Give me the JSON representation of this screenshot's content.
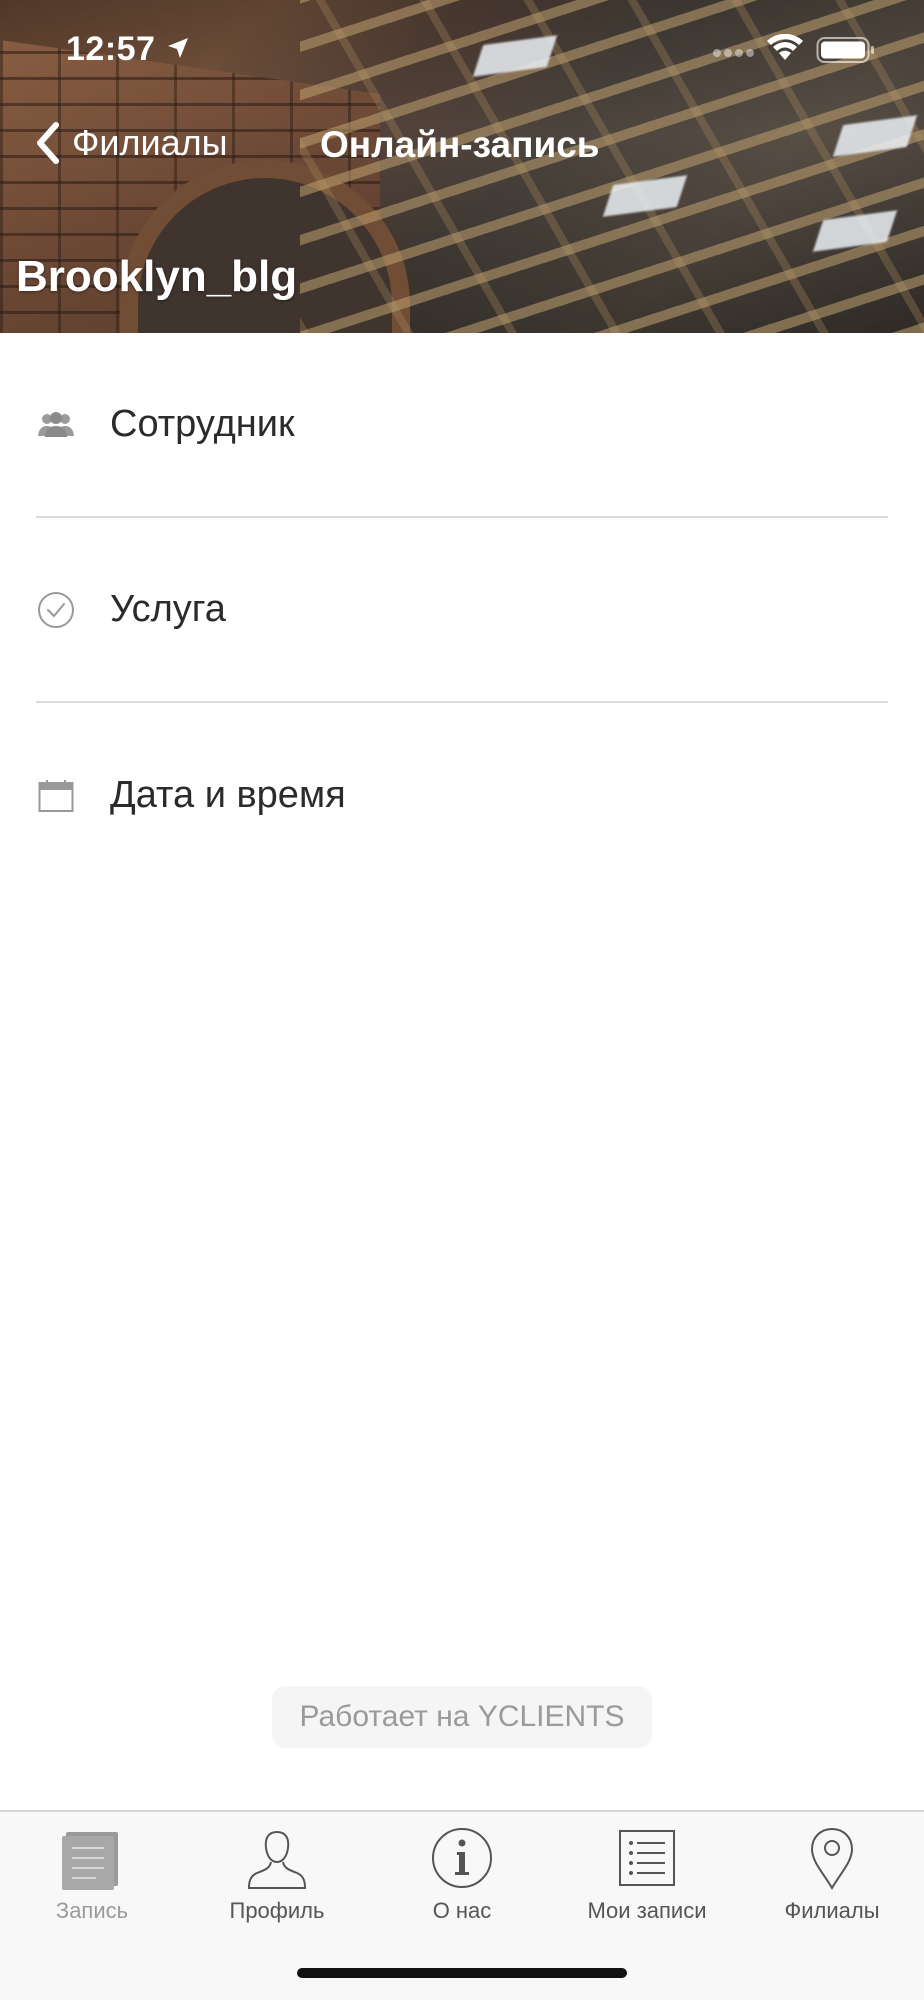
{
  "status_bar": {
    "time": "12:57"
  },
  "header": {
    "back_label": "Филиалы",
    "title": "Онлайн-запись",
    "branch_name": "Brooklyn_blg"
  },
  "menu": {
    "items": [
      {
        "label": "Сотрудник",
        "icon": "group-icon"
      },
      {
        "label": "Услуга",
        "icon": "check-circle-icon"
      },
      {
        "label": "Дата и время",
        "icon": "calendar-icon"
      }
    ]
  },
  "powered_by": "Работает на YCLIENTS",
  "tabbar": {
    "items": [
      {
        "label": "Запись",
        "icon": "notepad-icon",
        "active": true
      },
      {
        "label": "Профиль",
        "icon": "profile-icon",
        "active": false
      },
      {
        "label": "О нас",
        "icon": "info-icon",
        "active": false
      },
      {
        "label": "Мои записи",
        "icon": "list-icon",
        "active": false
      },
      {
        "label": "Филиалы",
        "icon": "map-pin-icon",
        "active": false
      }
    ]
  },
  "colors": {
    "row_divider": "#dcdcdc",
    "tab_label": "#555555",
    "tab_active_label": "#9a9a9a",
    "badge_bg": "#f5f5f5",
    "badge_text": "#9a9a9a"
  }
}
